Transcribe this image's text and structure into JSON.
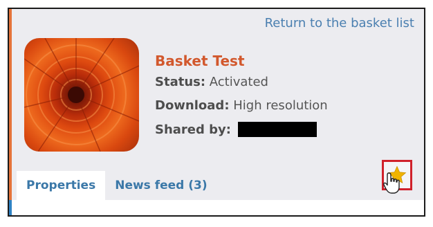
{
  "return_link": "Return to the basket list",
  "basket": {
    "title": "Basket Test",
    "status_label": "Status:",
    "status_value": "Activated",
    "download_label": "Download:",
    "download_value": "High resolution",
    "shared_label": "Shared by:"
  },
  "tabs": [
    {
      "label": "Properties",
      "active": true
    },
    {
      "label": "News feed (3)",
      "active": false
    }
  ],
  "colors": {
    "accent": "#e5733a",
    "link": "#4a7fb0",
    "title": "#d2582d",
    "highlight": "#d0212b",
    "star": "#f0b400"
  },
  "icons": {
    "favorite": "star-icon",
    "pointer": "hand-cursor-icon"
  }
}
